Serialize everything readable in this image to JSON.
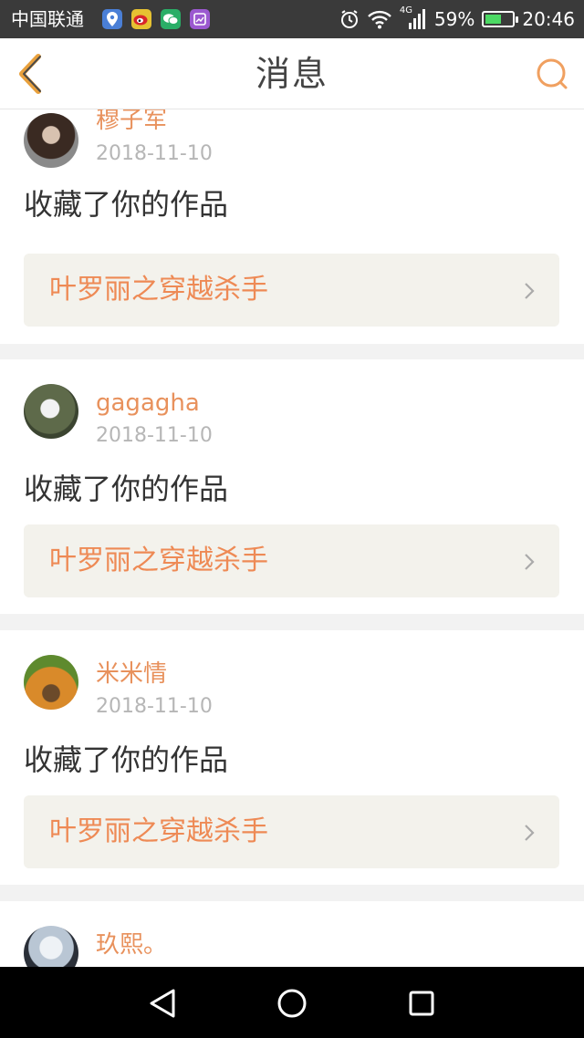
{
  "status_bar": {
    "carrier": "中国联通",
    "network": "4G",
    "battery": "59%",
    "battery_level": 0.59,
    "time": "20:46",
    "app_icons": [
      "location-app-icon",
      "weibo-icon",
      "wechat-icon",
      "gallery-app-icon"
    ]
  },
  "header": {
    "title": "消息",
    "back_icon": "chevron-left-icon",
    "search_icon": "search-icon",
    "accent": "#e8a03c"
  },
  "messages": [
    {
      "user": "穆子军",
      "date": "2018-11-10",
      "action": "收藏了你的作品",
      "work": "叶罗丽之穿越杀手"
    },
    {
      "user": "gagagha",
      "date": "2018-11-10",
      "action": "收藏了你的作品",
      "work": "叶罗丽之穿越杀手"
    },
    {
      "user": "米米情",
      "date": "2018-11-10",
      "action": "收藏了你的作品",
      "work": "叶罗丽之穿越杀手"
    },
    {
      "user": "玖熙。"
    }
  ],
  "colors": {
    "username": "#e8915c",
    "date": "#b6b6b6",
    "work_title": "#ee8a55",
    "work_bg": "#f3f2ec",
    "separator": "#f2f2f2"
  },
  "system_nav": {
    "back": "triangle-back-icon",
    "home": "circle-home-icon",
    "recents": "square-recents-icon"
  }
}
